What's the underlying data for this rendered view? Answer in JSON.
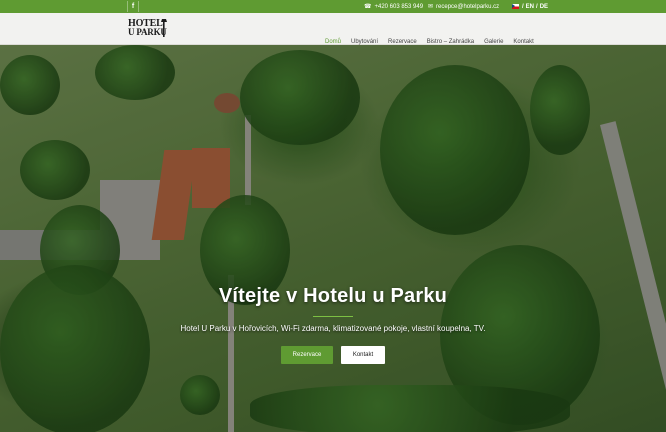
{
  "topbar": {
    "facebook_icon": "f",
    "phone_icon": "phone-icon",
    "phone": "+420 603 853 949",
    "email_icon": "mail-icon",
    "email": "recepce@hotelparku.cz",
    "languages": {
      "cz": "CZ",
      "sep1": "/",
      "en": "EN",
      "sep2": "/",
      "de": "DE"
    }
  },
  "header": {
    "logo_line1": "HOTEL",
    "logo_line2": "U PARKU",
    "nav": [
      {
        "label": "Domů",
        "active": true
      },
      {
        "label": "Ubytování"
      },
      {
        "label": "Rezervace"
      },
      {
        "label": "Bistro – Zahrádka"
      },
      {
        "label": "Galerie"
      },
      {
        "label": "Kontakt"
      }
    ]
  },
  "hero": {
    "title": "Vítejte v Hotelu u Parku",
    "subtitle": "Hotel U Parku v Hořovicích, Wi-Fi zdarma, klimatizované pokoje, vlastní koupelna, TV.",
    "btn_reservation": "Rezervace",
    "btn_contact": "Kontakt"
  },
  "colors": {
    "accent": "#5f9b32",
    "header_bg": "#f2f2f0"
  }
}
